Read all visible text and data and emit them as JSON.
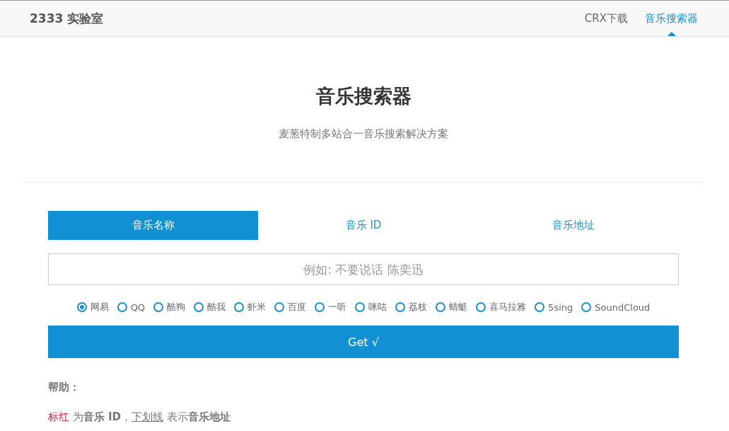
{
  "header": {
    "brand": "2333 实验室",
    "nav": [
      {
        "label": "CRX下载",
        "selected": false
      },
      {
        "label": "音乐搜索器",
        "selected": true
      }
    ]
  },
  "hero": {
    "title": "音乐搜索器",
    "subtitle": "麦葱特制多站合一音乐搜索解决方案"
  },
  "tabs": [
    {
      "label": "音乐名称",
      "selected": true
    },
    {
      "label": "音乐 ID",
      "selected": false
    },
    {
      "label": "音乐地址",
      "selected": false
    }
  ],
  "search": {
    "placeholder": "例如: 不要说话 陈奕迅"
  },
  "sources": [
    {
      "label": "网易",
      "selected": true
    },
    {
      "label": "QQ",
      "selected": false
    },
    {
      "label": "酷狗",
      "selected": false
    },
    {
      "label": "酷我",
      "selected": false
    },
    {
      "label": "虾米",
      "selected": false
    },
    {
      "label": "百度",
      "selected": false
    },
    {
      "label": "一听",
      "selected": false
    },
    {
      "label": "咪咕",
      "selected": false
    },
    {
      "label": "荔枝",
      "selected": false
    },
    {
      "label": "蜻蜓",
      "selected": false
    },
    {
      "label": "喜马拉雅",
      "selected": false
    },
    {
      "label": "5sing",
      "selected": false
    },
    {
      "label": "SoundCloud",
      "selected": false
    }
  ],
  "submit": "Get √",
  "help": {
    "title": "帮助：",
    "line": [
      {
        "kind": "red",
        "text": "标红"
      },
      {
        "kind": "plain",
        "text": " 为"
      },
      {
        "kind": "bold",
        "text": "音乐 ID"
      },
      {
        "kind": "plain",
        "text": "，"
      },
      {
        "kind": "underline",
        "text": "下划线"
      },
      {
        "kind": "plain",
        "text": " 表示"
      },
      {
        "kind": "bold",
        "text": "音乐地址"
      }
    ]
  }
}
